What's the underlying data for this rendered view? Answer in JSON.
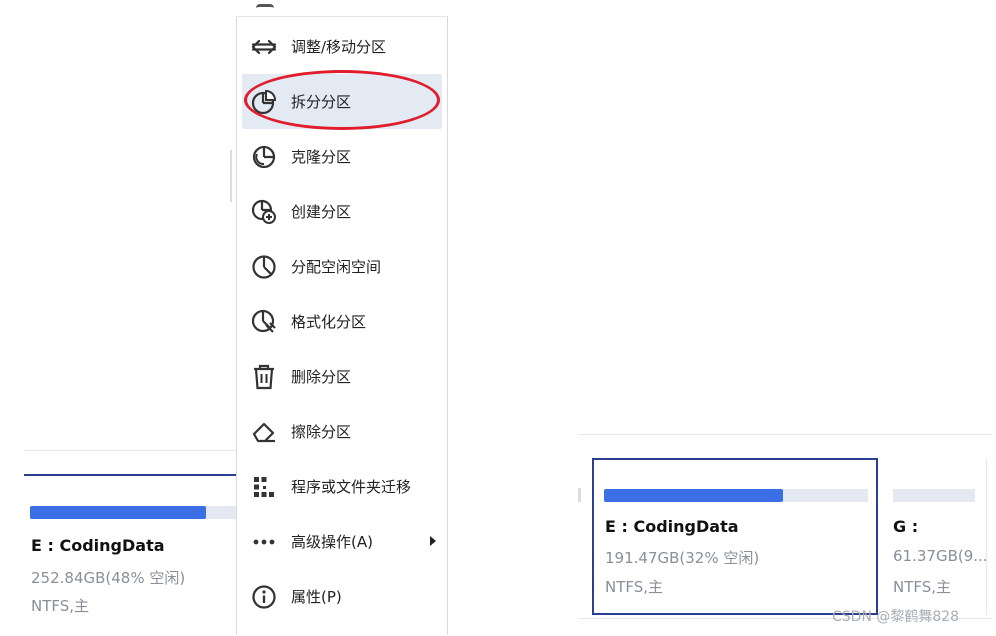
{
  "left_disk": {
    "name": "E : CodingData",
    "size": "252.84GB(48% 空闲)",
    "filesystem": "NTFS,主",
    "used_fraction": 0.82
  },
  "context_menu": {
    "items": [
      {
        "label": "调整/移动分区",
        "icon": "resize-arrows-icon"
      },
      {
        "label": "拆分分区",
        "icon": "split-partition-icon",
        "highlighted": true
      },
      {
        "label": "克隆分区",
        "icon": "clone-partition-icon"
      },
      {
        "label": "创建分区",
        "icon": "create-partition-icon"
      },
      {
        "label": "分配空闲空间",
        "icon": "allocate-space-icon"
      },
      {
        "label": "格式化分区",
        "icon": "format-partition-icon"
      },
      {
        "label": "删除分区",
        "icon": "trash-icon"
      },
      {
        "label": "擦除分区",
        "icon": "eraser-icon"
      },
      {
        "label": "程序或文件夹迁移",
        "icon": "migrate-grid-icon"
      },
      {
        "label": "高级操作(A)",
        "icon": "more-dots-icon",
        "has_submenu": true
      },
      {
        "label": "属性(P)",
        "icon": "info-icon"
      }
    ]
  },
  "right_disk": {
    "selected": {
      "name": "E : CodingData",
      "size": "191.47GB(32% 空闲)",
      "filesystem": "NTFS,主",
      "used_fraction": 0.68
    },
    "next": {
      "name": "G :",
      "size": "61.37GB(9...",
      "filesystem": "NTFS,主"
    }
  },
  "watermark": "CSDN @黎鹤舞828",
  "colors": {
    "accent": "#3a6fe6",
    "selected_border": "#2a3f8f",
    "highlight_bg": "#e4eaf4",
    "annotation_red": "#e01e2b"
  }
}
